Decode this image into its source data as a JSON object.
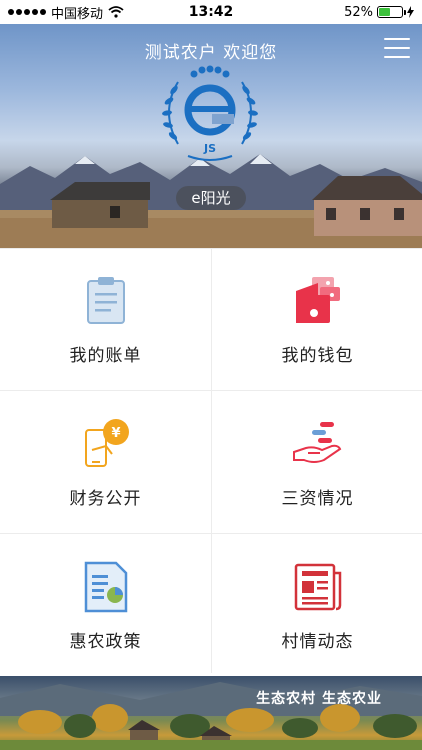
{
  "status_bar": {
    "carrier": "中国移动",
    "time": "13:42",
    "battery": "52%",
    "battery_level": 0.52
  },
  "hero": {
    "title": "测试农户 欢迎您",
    "logo_text": "JS",
    "badge": "e阳光"
  },
  "tiles": [
    {
      "label": "我的账单",
      "icon": "bill-clipboard-icon"
    },
    {
      "label": "我的钱包",
      "icon": "wallet-icon"
    },
    {
      "label": "财务公开",
      "icon": "finance-phone-coin-icon"
    },
    {
      "label": "三资情况",
      "icon": "assets-hand-icon"
    },
    {
      "label": "惠农政策",
      "icon": "policy-document-icon"
    },
    {
      "label": "村情动态",
      "icon": "newspaper-icon"
    }
  ],
  "banner": {
    "text": "生态农村 生态农业"
  },
  "colors": {
    "accent_blue": "#1b6fc2",
    "wallet_red": "#e8334a",
    "finance_orange": "#f2a51e",
    "newspaper_red": "#d2323a"
  }
}
